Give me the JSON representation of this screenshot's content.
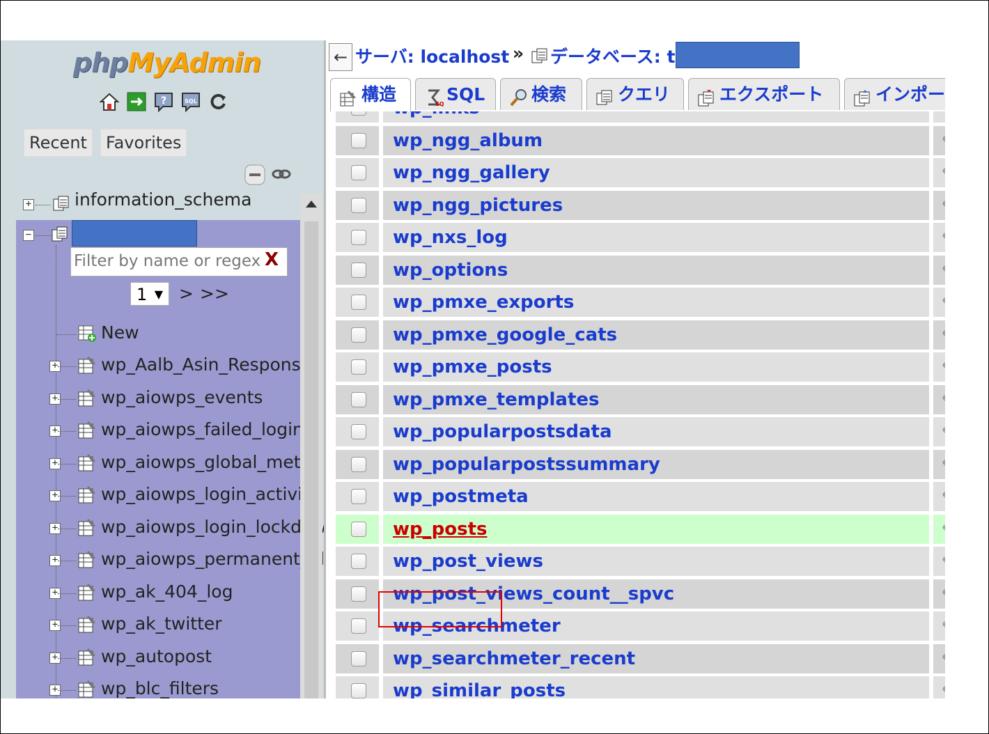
{
  "logo": {
    "part1": "php",
    "part2": "MyAdmin"
  },
  "nav": {
    "icons": [
      "home-icon",
      "logout-icon",
      "help-icon",
      "sql-docs-icon",
      "reload-icon"
    ],
    "recent_label": "Recent",
    "favorites_label": "Favorites",
    "tree": {
      "info_schema": "information_schema",
      "filter_placeholder": "Filter by name or regex",
      "filter_clear": "X",
      "page_value": "1",
      "page_next": ">",
      "page_last": ">>",
      "new_label": "New",
      "tables": [
        "wp_Aalb_Asin_Response",
        "wp_aiowps_events",
        "wp_aiowps_failed_logins",
        "wp_aiowps_global_meta",
        "wp_aiowps_login_activity",
        "wp_aiowps_login_lockdown",
        "wp_aiowps_permanent_block",
        "wp_ak_404_log",
        "wp_ak_twitter",
        "wp_autopost",
        "wp_blc_filters"
      ]
    }
  },
  "breadcrumb": {
    "back": "←",
    "server": "サーバ: localhost",
    "sep": "»",
    "database": "データベース: t"
  },
  "tabs": [
    {
      "label": "構造",
      "icon": "structure-icon",
      "active": true
    },
    {
      "label": "SQL",
      "icon": "sql-icon",
      "active": false
    },
    {
      "label": "検索",
      "icon": "search-icon",
      "active": false
    },
    {
      "label": "クエリ",
      "icon": "query-icon",
      "active": false
    },
    {
      "label": "エクスポート",
      "icon": "export-icon",
      "active": false
    },
    {
      "label": "インポー",
      "icon": "import-icon",
      "active": false
    }
  ],
  "table_list": {
    "rows": [
      {
        "name": "wp_links"
      },
      {
        "name": "wp_ngg_album"
      },
      {
        "name": "wp_ngg_gallery"
      },
      {
        "name": "wp_ngg_pictures"
      },
      {
        "name": "wp_nxs_log"
      },
      {
        "name": "wp_options"
      },
      {
        "name": "wp_pmxe_exports"
      },
      {
        "name": "wp_pmxe_google_cats"
      },
      {
        "name": "wp_pmxe_posts"
      },
      {
        "name": "wp_pmxe_templates"
      },
      {
        "name": "wp_popularpostsdata"
      },
      {
        "name": "wp_popularpostssummary"
      },
      {
        "name": "wp_postmeta"
      },
      {
        "name": "wp_posts",
        "highlighted": true
      },
      {
        "name": "wp_post_views"
      },
      {
        "name": "wp_post_views_count__spvc"
      },
      {
        "name": "wp_searchmeter"
      },
      {
        "name": "wp_searchmeter_recent"
      },
      {
        "name": "wp_similar_posts"
      }
    ]
  },
  "colors": {
    "accent": "#1a3ccd",
    "highlight_row": "#ccffcc",
    "selected_db_bg": "#9a9ad0",
    "annotation": "#e00000"
  }
}
